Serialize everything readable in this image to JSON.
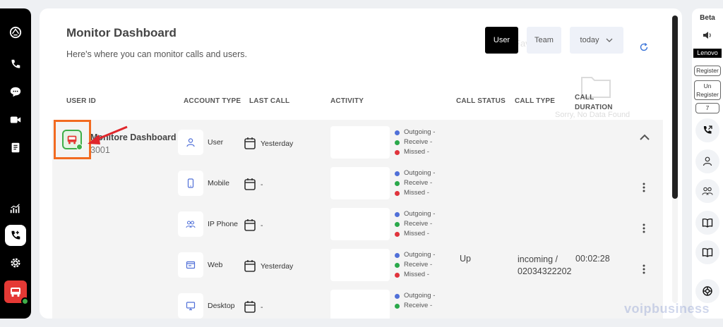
{
  "header": {
    "title": "Monitor Dashboard",
    "subtitle": "Here's where you can monitor calls and users."
  },
  "filters": {
    "user_label": "User",
    "team_label": "Team",
    "range_label": "today"
  },
  "overlay": {
    "favourites_title": "Favourites",
    "empty_text": "Sorry, No Data Found"
  },
  "columns": {
    "user_id": "USER ID",
    "account_type": "ACCOUNT TYPE",
    "last_call": "LAST CALL",
    "activity": "ACTIVITY",
    "call_status": "CALL STATUS",
    "call_type": "CALL TYPE",
    "call_duration_line1": "CALL",
    "call_duration_line2": "DURATION"
  },
  "user": {
    "name": "Monitore Dashboard",
    "extension": "3001"
  },
  "legend": {
    "outgoing": "Outgoing  -",
    "receive": "Receive  -",
    "missed": "Missed  -",
    "colors": {
      "outgoing": "#4f6fd8",
      "receive": "#2aa84a",
      "missed": "#e0333c"
    }
  },
  "rows": [
    {
      "account_type": "User",
      "icon": "user-icon",
      "last_call": "Yesterday"
    },
    {
      "account_type": "Mobile",
      "icon": "mobile-icon",
      "last_call": "-"
    },
    {
      "account_type": "IP Phone",
      "icon": "group-icon",
      "last_call": "-"
    },
    {
      "account_type": "Web",
      "icon": "web-icon",
      "last_call": "Yesterday"
    },
    {
      "account_type": "Desktop",
      "icon": "desktop-icon",
      "last_call": "-"
    }
  ],
  "call_info": {
    "status": "Up",
    "type_line1": "incoming /",
    "type_line2": "02034322202",
    "duration": "00:02:28"
  },
  "right_panel": {
    "beta": "Beta",
    "device": "Lenovo",
    "register": "Register",
    "unregister_line1": "Un",
    "unregister_line2": "Register",
    "count": "7"
  },
  "watermark": "voipbusiness"
}
